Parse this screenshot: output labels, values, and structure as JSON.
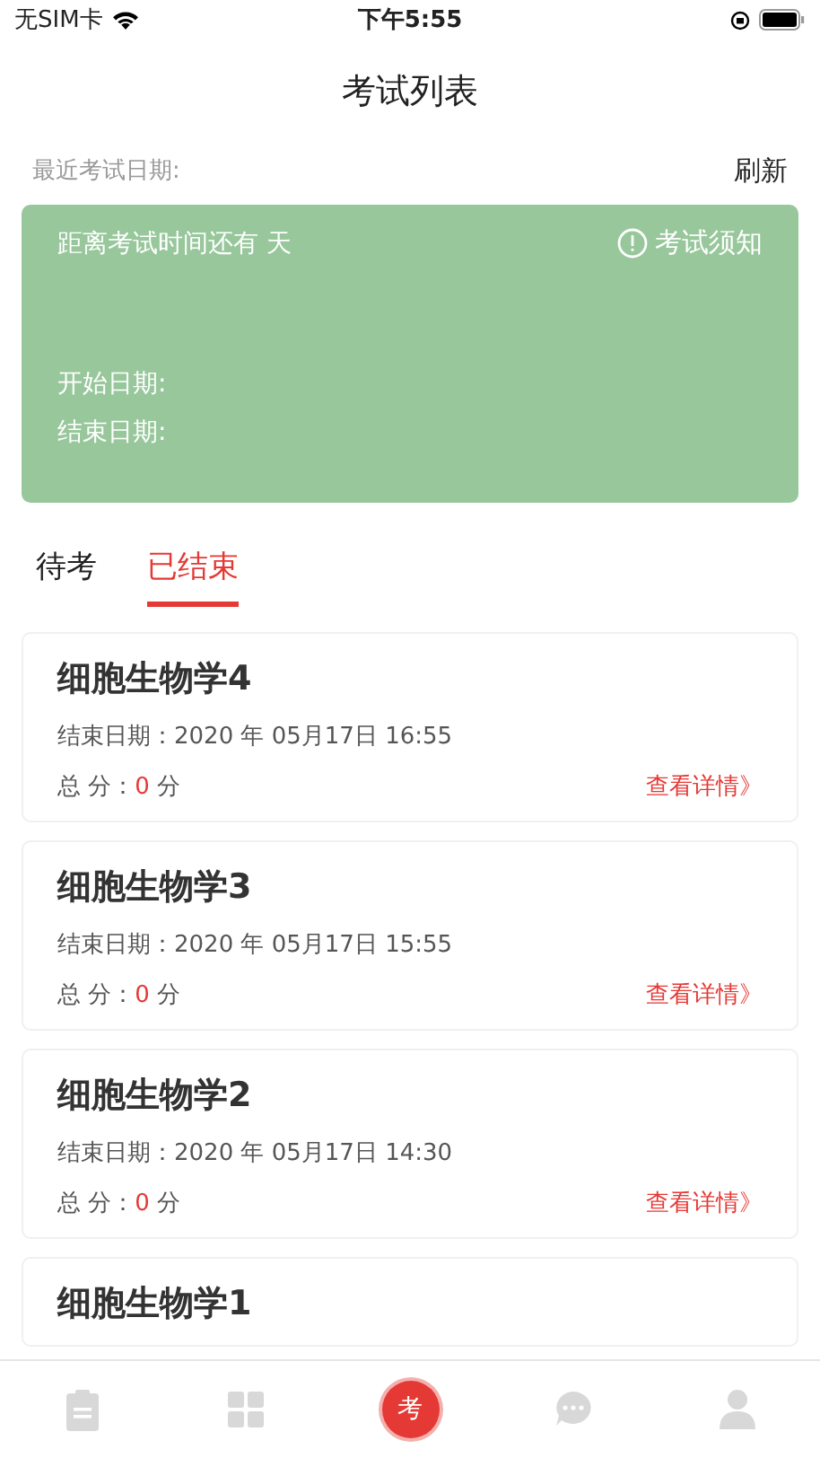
{
  "status_bar": {
    "carrier": "无SIM卡",
    "time": "下午5:55"
  },
  "title": "考试列表",
  "recent": {
    "label": "最近考试日期:",
    "refresh": "刷新"
  },
  "countdown": {
    "remaining": "距离考试时间还有  天",
    "notice": "考试须知",
    "start": "开始日期:",
    "end": "结束日期:"
  },
  "tabs": [
    {
      "label": "待考",
      "selected": false
    },
    {
      "label": "已结束",
      "selected": true
    }
  ],
  "exams": [
    {
      "name": "细胞生物学4",
      "end_date": "结束日期：2020 年 05月17日 16:55",
      "score_label": "总  分：",
      "score": "0",
      "score_unit": "分",
      "link": "查看详情》"
    },
    {
      "name": "细胞生物学3",
      "end_date": "结束日期：2020 年 05月17日 15:55",
      "score_label": "总  分：",
      "score": "0",
      "score_unit": "分",
      "link": "查看详情》"
    },
    {
      "name": "细胞生物学2",
      "end_date": "结束日期：2020 年 05月17日 14:30",
      "score_label": "总  分：",
      "score": "0",
      "score_unit": "分",
      "link": "查看详情》"
    },
    {
      "name": "细胞生物学1"
    }
  ],
  "tab_bar": [
    {
      "kind": "clipboard",
      "selected": false
    },
    {
      "kind": "grid",
      "selected": false
    },
    {
      "kind": "badge",
      "label": "考",
      "selected": true
    },
    {
      "kind": "chat",
      "selected": false
    },
    {
      "kind": "person",
      "selected": false
    }
  ]
}
